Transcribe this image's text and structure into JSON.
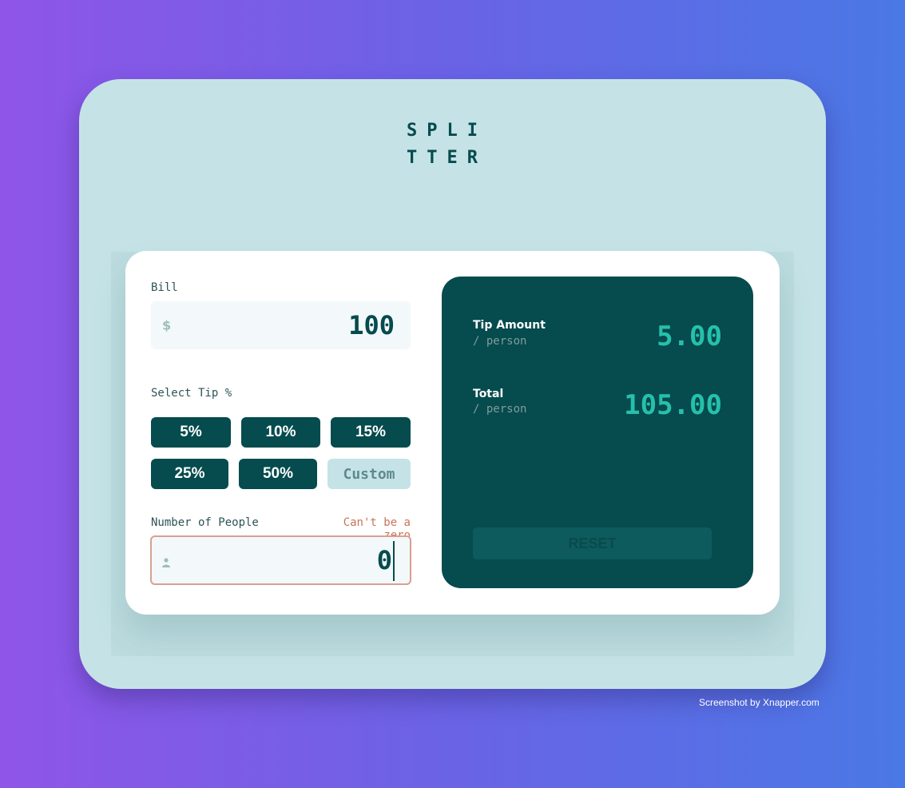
{
  "app": {
    "logo_line1": "SPLI",
    "logo_line2": "TTER"
  },
  "bill": {
    "label": "Bill",
    "currency_icon": "$",
    "value": "100"
  },
  "tip": {
    "label": "Select Tip %",
    "options": [
      "5%",
      "10%",
      "15%",
      "25%",
      "50%"
    ],
    "custom_placeholder": "Custom"
  },
  "people": {
    "label": "Number of People",
    "error": "Can't be a zero",
    "value": "0",
    "icon": "person-icon"
  },
  "results": {
    "tip_label": "Tip Amount",
    "tip_sub": "/ person",
    "tip_value": "5.00",
    "total_label": "Total",
    "total_sub": "/ person",
    "total_value": "105.00",
    "reset_label": "RESET"
  },
  "credit": "Screenshot by Xnapper.com",
  "colors": {
    "primary": "#064b4e",
    "accent": "#26c0ab",
    "error": "#c9745a",
    "frame": "#c5e3e6"
  }
}
